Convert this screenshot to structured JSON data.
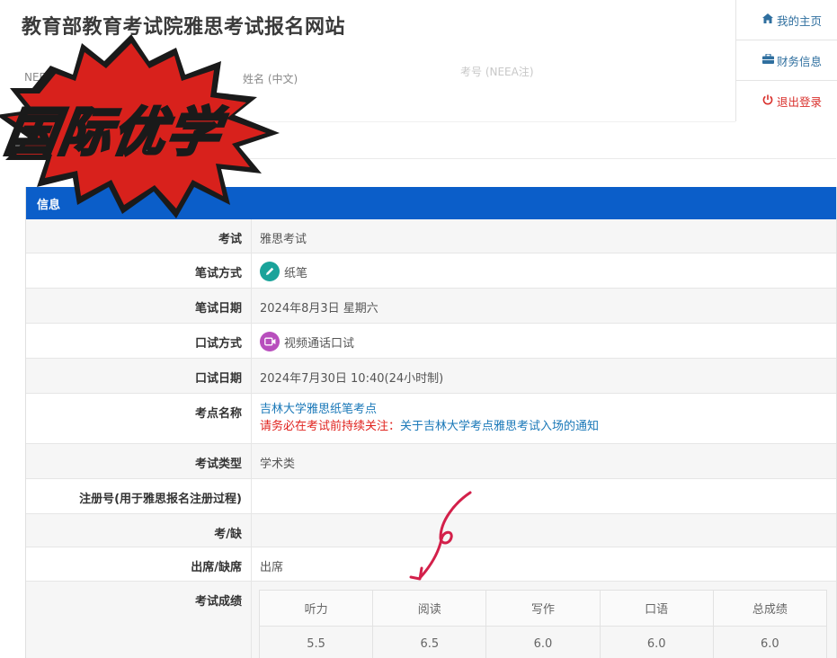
{
  "header": {
    "site_title": "教育部教育考试院雅思考试报名网站",
    "neea_label": "NEEA",
    "name_label": "姓名 (中文)",
    "faded_label": "考号 (NEEA注)"
  },
  "nav": [
    {
      "label": "我的主页",
      "icon": "home-icon"
    },
    {
      "label": "财务信息",
      "icon": "briefcase-icon"
    },
    {
      "label": "退出登录",
      "icon": "power-icon"
    }
  ],
  "watermark": {
    "text": "国际优学"
  },
  "panel": {
    "title": "信息"
  },
  "rows": {
    "exam": {
      "label": "考试",
      "value": "雅思考试"
    },
    "written_mode": {
      "label": "笔试方式",
      "value": "纸笔",
      "icon": "pencil-icon",
      "color": "#1aa39a"
    },
    "written_date": {
      "label": "笔试日期",
      "value": "2024年8月3日 星期六"
    },
    "oral_mode": {
      "label": "口试方式",
      "value": "视频通话口试",
      "icon": "video-icon",
      "color": "#b84fbd"
    },
    "oral_date": {
      "label": "口试日期",
      "value": "2024年7月30日 10:40(24小时制)"
    },
    "venue": {
      "label": "考点名称",
      "value": "吉林大学雅思纸笔考点",
      "notice_prefix": "请务必在考试前持续关注：",
      "notice_link": "关于吉林大学考点雅思考试入场的通知"
    },
    "exam_type": {
      "label": "考试类型",
      "value": "学术类"
    },
    "reg_no": {
      "label": "注册号(用于雅思报名注册过程)",
      "value": ""
    },
    "attendance_code": {
      "label": "考/缺",
      "value": ""
    },
    "attendance": {
      "label": "出席/缺席",
      "value": "出席"
    },
    "scores": {
      "label": "考试成绩",
      "headers": [
        "听力",
        "阅读",
        "写作",
        "口语",
        "总成绩"
      ],
      "values": [
        "5.5",
        "6.5",
        "6.0",
        "6.0",
        "6.0"
      ]
    }
  },
  "colors": {
    "accent": "#0b5ec9",
    "link": "#1a78b8",
    "warning": "#e0241f",
    "badge": "#d8211c"
  }
}
